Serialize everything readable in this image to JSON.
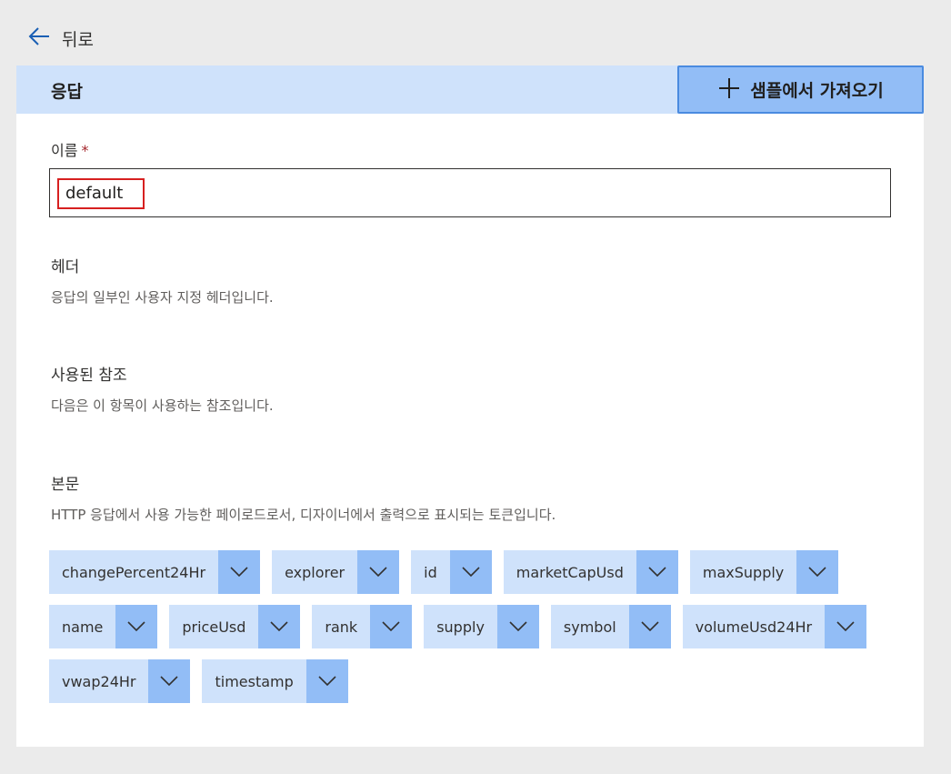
{
  "back": {
    "label": "뒤로"
  },
  "header": {
    "title": "응답",
    "import_label": "샘플에서 가져오기"
  },
  "name_field": {
    "label": "이름",
    "required_mark": "*",
    "value": "default"
  },
  "headers_section": {
    "title": "헤더",
    "description": "응답의 일부인 사용자 지정 헤더입니다."
  },
  "refs_section": {
    "title": "사용된 참조",
    "description": "다음은 이 항목이 사용하는 참조입니다."
  },
  "body_section": {
    "title": "본문",
    "description": "HTTP 응답에서 사용 가능한 페이로드로서, 디자이너에서 출력으로 표시되는 토큰입니다.",
    "tokens": [
      [
        "changePercent24Hr",
        "explorer",
        "id",
        "marketCapUsd",
        "maxSupply"
      ],
      [
        "name",
        "priceUsd",
        "rank",
        "supply",
        "symbol",
        "volumeUsd24Hr"
      ],
      [
        "vwap24Hr",
        "timestamp"
      ]
    ]
  },
  "colors": {
    "accent_light": "#cfe2fb",
    "accent_mid": "#92bdf6",
    "accent_border": "#4a8be0",
    "highlight": "#d72020"
  },
  "icons": {
    "back": "arrow-left-icon",
    "import": "plus-icon",
    "token": "chevron-down-icon"
  }
}
